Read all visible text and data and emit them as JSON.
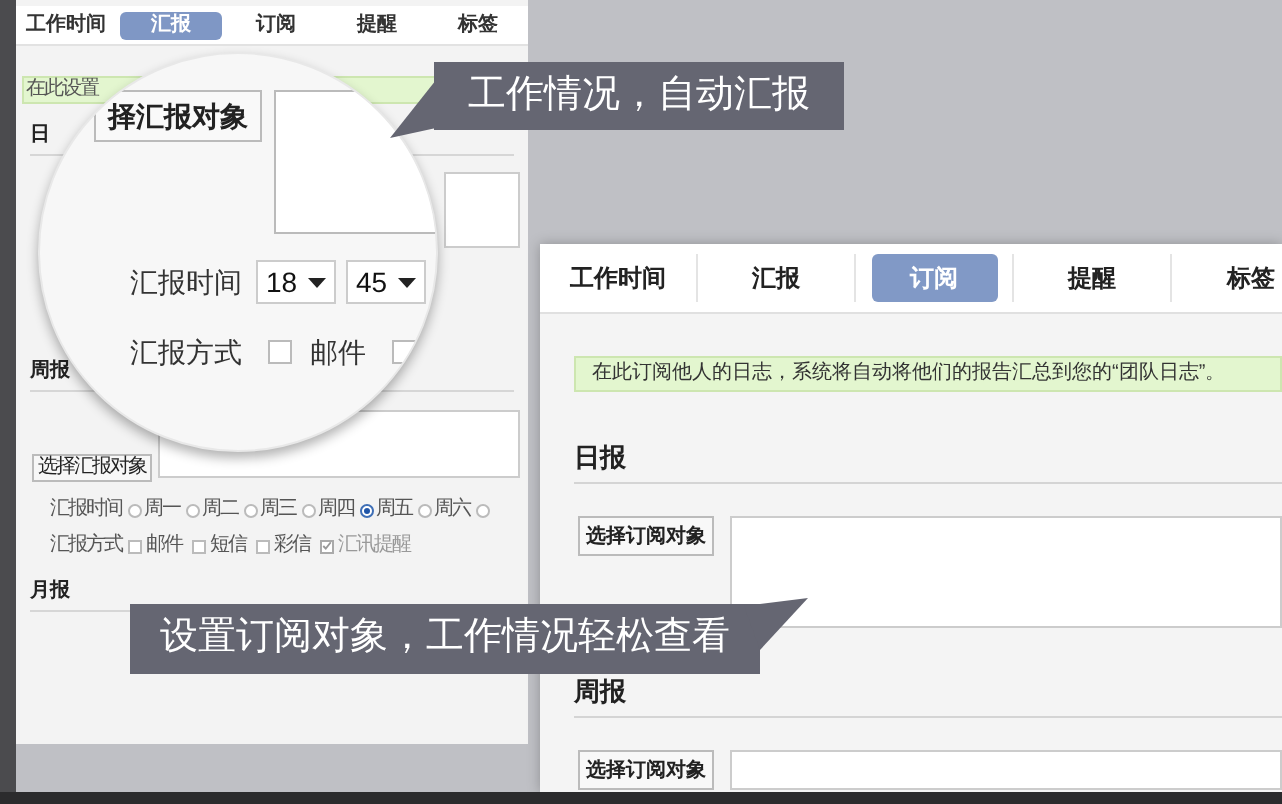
{
  "back_panel": {
    "tabs": [
      {
        "label": "工作时间",
        "selected": false
      },
      {
        "label": "汇报",
        "selected": true
      },
      {
        "label": "订阅",
        "selected": false
      },
      {
        "label": "提醒",
        "selected": false
      },
      {
        "label": "标签",
        "selected": false
      }
    ],
    "notice": "在此设置",
    "daily": {
      "heading": "日"
    },
    "weekly": {
      "heading": "周报",
      "button": "选择汇报对象",
      "time_label": "汇报时间",
      "days": [
        {
          "label": "周一",
          "selected": false
        },
        {
          "label": "周二",
          "selected": false
        },
        {
          "label": "周三",
          "selected": false
        },
        {
          "label": "周四",
          "selected": false
        },
        {
          "label": "周五",
          "selected": true
        },
        {
          "label": "周六",
          "selected": false
        },
        {
          "selected": false
        }
      ],
      "method_label": "汇报方式",
      "methods": [
        {
          "label": "邮件",
          "checked": false
        },
        {
          "label": "短信",
          "checked": false
        },
        {
          "label": "彩信",
          "checked": false
        },
        {
          "label": "汇讯提醒",
          "checked": true
        }
      ]
    },
    "monthly": {
      "heading": "月报"
    }
  },
  "magnifier": {
    "button": "择汇报对象",
    "time_label": "汇报时间",
    "hour": "18",
    "minute": "45",
    "method_label": "汇报方式",
    "methods": [
      {
        "label": "邮件",
        "checked": false
      },
      {
        "checked": false
      }
    ]
  },
  "callouts": [
    "工作情况，自动汇报",
    "设置订阅对象，工作情况轻松查看"
  ],
  "front_panel": {
    "tabs": [
      {
        "label": "工作时间",
        "selected": false
      },
      {
        "label": "汇报",
        "selected": false
      },
      {
        "label": "订阅",
        "selected": true
      },
      {
        "label": "提醒",
        "selected": false
      },
      {
        "label": "标签",
        "selected": false
      }
    ],
    "notice": "在此订阅他人的日志，系统将自动将他们的报告汇总到您的“团队日志”。",
    "sections": [
      {
        "heading": "日报",
        "button": "选择订阅对象"
      },
      {
        "heading": "周报",
        "button": "选择订阅对象"
      }
    ]
  }
}
